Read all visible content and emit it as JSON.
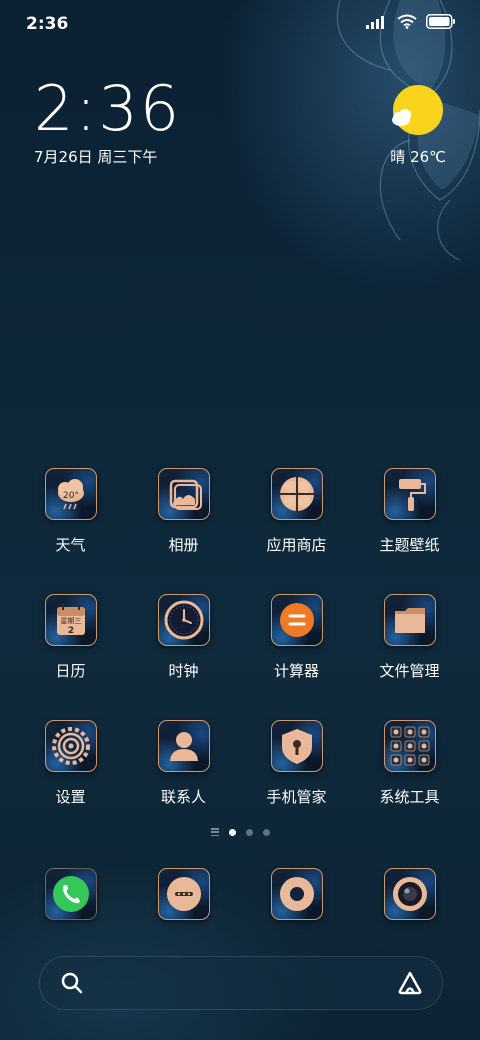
{
  "status_bar": {
    "time": "2:36"
  },
  "clock_widget": {
    "time": "2:36",
    "date": "7月26日 周三下午"
  },
  "weather": {
    "text": "晴 26℃",
    "icon": "sun-cloud-icon"
  },
  "apps": [
    {
      "label": "天气",
      "icon": "weather-icon"
    },
    {
      "label": "相册",
      "icon": "gallery-icon"
    },
    {
      "label": "应用商店",
      "icon": "app-store-icon"
    },
    {
      "label": "主题壁纸",
      "icon": "paint-roller-icon"
    },
    {
      "label": "日历",
      "icon": "calendar-icon"
    },
    {
      "label": "时钟",
      "icon": "clock-icon"
    },
    {
      "label": "计算器",
      "icon": "calculator-icon"
    },
    {
      "label": "文件管理",
      "icon": "folder-icon"
    },
    {
      "label": "设置",
      "icon": "gear-icon"
    },
    {
      "label": "联系人",
      "icon": "contact-icon"
    },
    {
      "label": "手机管家",
      "icon": "security-shield-icon"
    },
    {
      "label": "系统工具",
      "icon": "tools-folder-icon"
    }
  ],
  "weather_app_icon_text": "20°",
  "calendar_icon": {
    "weekday": "星期三",
    "day": "2"
  },
  "pager": {
    "pages": 3,
    "active": 1
  },
  "dock": [
    {
      "icon": "phone-icon"
    },
    {
      "icon": "messages-icon"
    },
    {
      "icon": "browser-icon"
    },
    {
      "icon": "camera-icon"
    }
  ],
  "search_bar": {
    "search_icon": "search-icon",
    "assistant_icon": "assistant-icon"
  },
  "colors": {
    "accent_gold": "#c99a72",
    "sun": "#f8d51c",
    "phone_green": "#35c759"
  }
}
